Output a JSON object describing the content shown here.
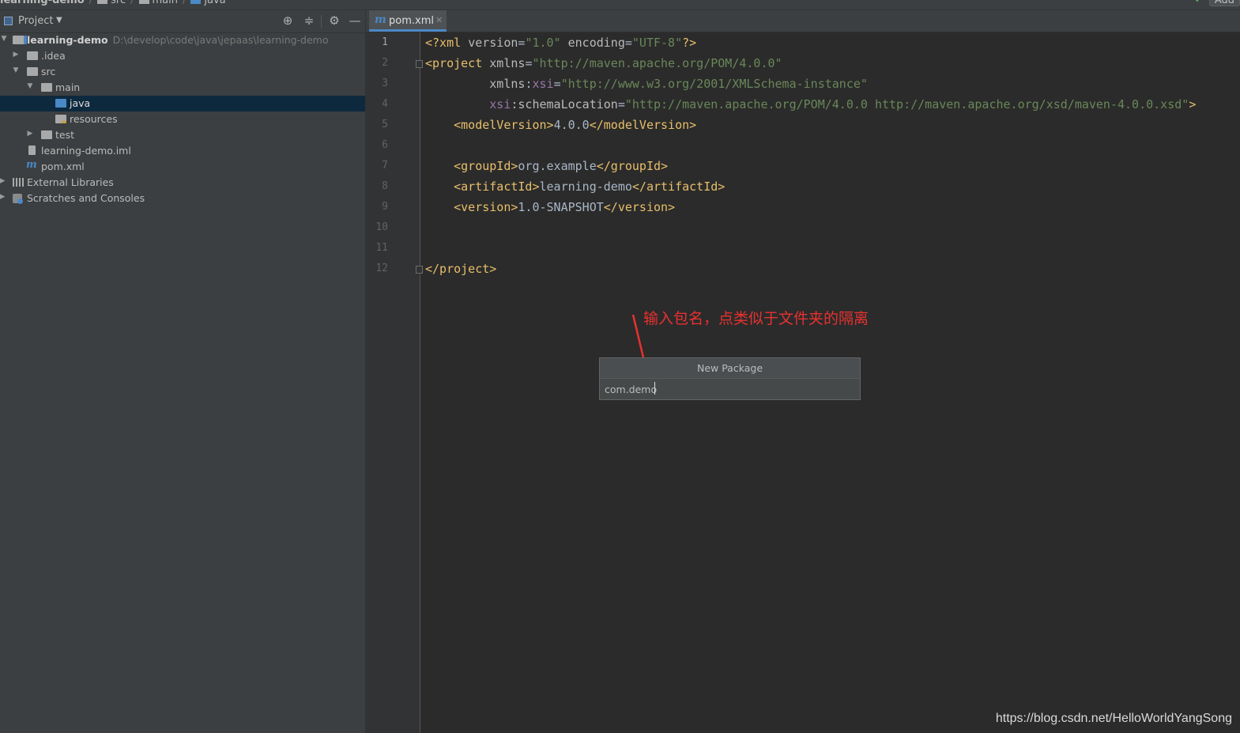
{
  "breadcrumb": {
    "items": [
      "learning-demo",
      "src",
      "main",
      "java"
    ],
    "add_label": "Add"
  },
  "project_panel": {
    "title": "Project",
    "tree": [
      {
        "label": "learning-demo",
        "path": "D:\\develop\\code\\java\\jepaas\\learning-demo"
      },
      {
        "label": ".idea"
      },
      {
        "label": "src"
      },
      {
        "label": "main"
      },
      {
        "label": "java",
        "selected": true
      },
      {
        "label": "resources"
      },
      {
        "label": "test"
      },
      {
        "label": "learning-demo.iml"
      },
      {
        "label": "pom.xml"
      },
      {
        "label": "External Libraries"
      },
      {
        "label": "Scratches and Consoles"
      }
    ]
  },
  "editor": {
    "tab_label": "pom.xml",
    "line_numbers": [
      "1",
      "2",
      "3",
      "4",
      "5",
      "6",
      "7",
      "8",
      "9",
      "10",
      "11",
      "12"
    ]
  },
  "annotation": "输入包名，点类似于文件夹的隔离",
  "dialog": {
    "title": "New Package",
    "input_value": "com.demo"
  },
  "watermark": "https://blog.csdn.net/HelloWorldYangSong",
  "colors": {
    "accent": "#4a88c7",
    "selection": "#0d293e",
    "annotation": "#e8312f",
    "xml_tag": "#e8bf6a",
    "xml_string": "#6a8759",
    "xml_namespace": "#9876aa"
  }
}
